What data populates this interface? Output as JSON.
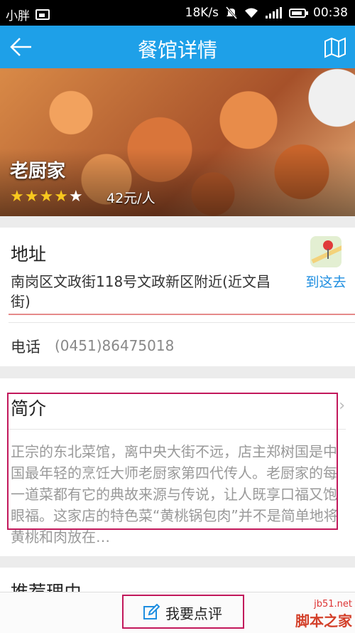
{
  "status_bar": {
    "carrier": "小胖",
    "net_speed": "18K/s",
    "time": "00:38"
  },
  "app_bar": {
    "title": "餐馆详情",
    "back_icon": "arrow-left-icon",
    "map_icon": "map-icon"
  },
  "restaurant": {
    "name": "老厨家",
    "rating": 4.5,
    "price": "42元/人"
  },
  "address_section": {
    "label": "地址",
    "text": "南岗区文政街118号文政新区附近(近文昌街)",
    "goto_label": "到这去"
  },
  "phone_section": {
    "label": "电话",
    "number": "(0451)86475018"
  },
  "intro_section": {
    "label": "简介",
    "text": "正宗的东北菜馆，离中央大街不远，店主郑树国是中国最年轻的烹饪大师老厨家第四代传人。老厨家的每一道菜都有它的典故来源与传说，让人既享口福又饱眼福。这家店的特色菜“黄桃锅包肉”并不是简单地将黄桃和肉放在…"
  },
  "reason_section": {
    "label": "推荐理由"
  },
  "bottom": {
    "review_button": "我要点评"
  },
  "watermark": {
    "site": "jb51.net",
    "brand": "脚本之家"
  },
  "colors": {
    "app_bar": "#1ea0e8",
    "star": "#f8c81e",
    "link": "#1e8ee0",
    "highlight_box": "#c2185b"
  }
}
